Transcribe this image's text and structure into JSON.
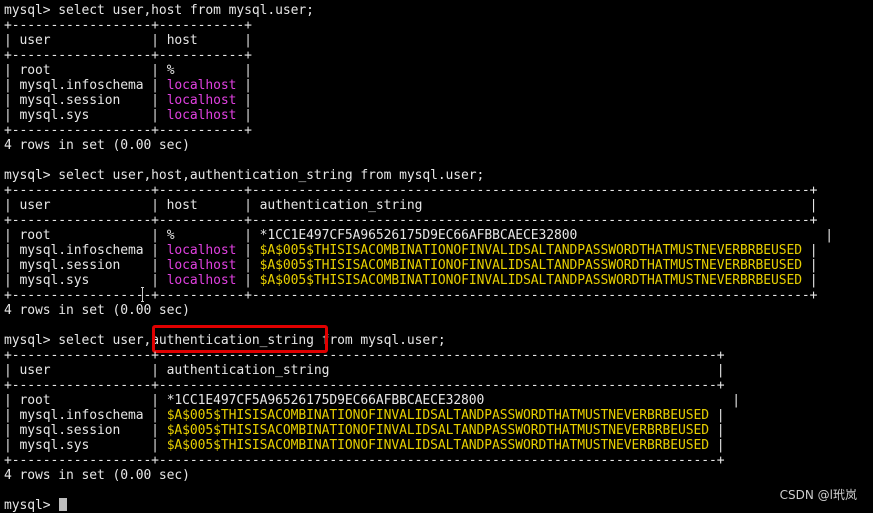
{
  "terminal": {
    "queries": [
      {
        "command": "mysql> select user,host from mysql.user;",
        "border": "+------------------+-----------+",
        "header": {
          "user": "| user             | ",
          "host": "host      |"
        },
        "rows": [
          {
            "user": "| root             | ",
            "host": "%        ",
            "end": " |"
          },
          {
            "user": "| mysql.infoschema | ",
            "host": "localhost",
            "end": " |"
          },
          {
            "user": "| mysql.session    | ",
            "host": "localhost",
            "end": " |"
          },
          {
            "user": "| mysql.sys        | ",
            "host": "localhost",
            "end": " |"
          }
        ],
        "result": "4 rows in set (0.00 sec)"
      },
      {
        "command": "mysql> select user,host,authentication_string from mysql.user;",
        "border": "+------------------+-----------+------------------------------------------------------------------------+",
        "header": "| user             | host      | authentication_string                                                  |",
        "rows": [
          {
            "pre": "| root             | ",
            "host": "%        ",
            "mid": " | ",
            "auth_prefix": "*1CC1E497CF5A96526175D9EC66AFBBCAECE32800",
            "auth_rest": "",
            "end": "                                |"
          },
          {
            "pre": "| mysql.infoschema | ",
            "host": "localhost",
            "mid": " | ",
            "auth_prefix": "$A$005",
            "auth_rest": "$THISISACOMBINATIONOFINVALIDSALTANDPASSWORDTHATMUSTNEVERBRBEUSED",
            "end": " |"
          },
          {
            "pre": "| mysql.session    | ",
            "host": "localhost",
            "mid": " | ",
            "auth_prefix": "$A$005",
            "auth_rest": "$THISISACOMBINATIONOFINVALIDSALTANDPASSWORDTHATMUSTNEVERBRBEUSED",
            "end": " |"
          },
          {
            "pre": "| mysql.sys        | ",
            "host": "localhost",
            "mid": " | ",
            "auth_prefix": "$A$005",
            "auth_rest": "$THISISACOMBINATIONOFINVALIDSALTANDPASSWORDTHATMUSTNEVERBRBEUSED",
            "end": " |"
          }
        ],
        "result": "4 rows in set (0.00 sec)"
      },
      {
        "command_pre": "mysql> select user,",
        "command_highlight": "authentication_string",
        "command_post": " from mysql.user;",
        "border": "+------------------+------------------------------------------------------------------------+",
        "header": "| user             | authentication_string                                                  |",
        "rows": [
          {
            "pre": "| root             | ",
            "auth_prefix": "*1CC1E497CF5A96526175D9EC66AFBBCAECE32800",
            "auth_rest": "",
            "end": "                                |"
          },
          {
            "pre": "| mysql.infoschema | ",
            "auth_prefix": "$A$005",
            "auth_rest": "$THISISACOMBINATIONOFINVALIDSALTANDPASSWORDTHATMUSTNEVERBRBEUSED",
            "end": " |"
          },
          {
            "pre": "| mysql.session    | ",
            "auth_prefix": "$A$005",
            "auth_rest": "$THISISACOMBINATIONOFINVALIDSALTANDPASSWORDTHATMUSTNEVERBRBEUSED",
            "end": " |"
          },
          {
            "pre": "| mysql.sys        | ",
            "auth_prefix": "$A$005",
            "auth_rest": "$THISISACOMBINATIONOFINVALIDSALTANDPASSWORDTHATMUSTNEVERBRBEUSED",
            "end": " |"
          }
        ],
        "result": "4 rows in set (0.00 sec)"
      }
    ],
    "prompt": "mysql> "
  },
  "colors": {
    "background": "#000000",
    "text": "#e6e6e6",
    "localhost": "#e040e0",
    "auth_hash": "#e8d000",
    "highlight_box": "#e00000"
  },
  "watermark": "CSDN @l玳岚"
}
